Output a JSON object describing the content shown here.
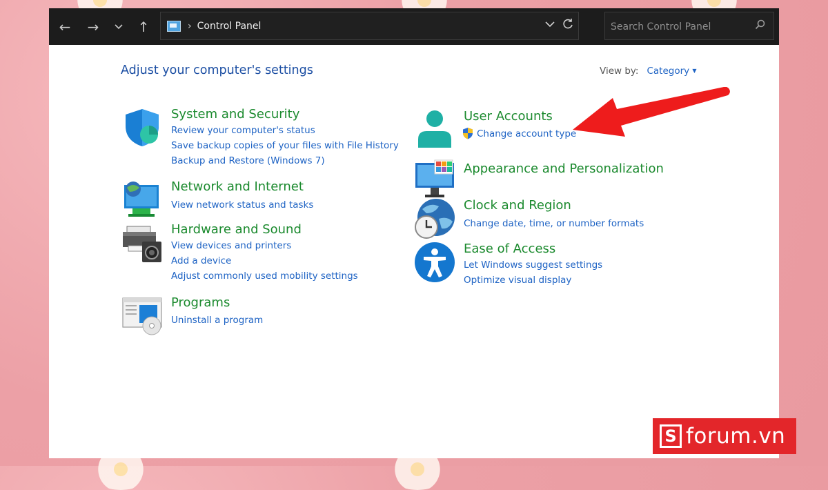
{
  "toolbar": {
    "back_icon": "arrow-left-icon",
    "forward_icon": "arrow-right-icon",
    "recent_icon": "chevron-down-icon",
    "up_icon": "arrow-up-icon",
    "address_separator": "›",
    "address_location": "Control Panel",
    "search_placeholder": "Search Control Panel"
  },
  "page": {
    "heading": "Adjust your computer's settings",
    "view_by_label": "View by:",
    "view_by_value": "Category"
  },
  "categories": {
    "system_security": {
      "title": "System and Security",
      "links": [
        "Review your computer's status",
        "Save backup copies of your files with File History",
        "Backup and Restore (Windows 7)"
      ]
    },
    "network": {
      "title": "Network and Internet",
      "links": [
        "View network status and tasks"
      ]
    },
    "hardware": {
      "title": "Hardware and Sound",
      "links": [
        "View devices and printers",
        "Add a device",
        "Adjust commonly used mobility settings"
      ]
    },
    "programs": {
      "title": "Programs",
      "links": [
        "Uninstall a program"
      ]
    },
    "user_accounts": {
      "title": "User Accounts",
      "links": [
        "Change account type"
      ]
    },
    "appearance": {
      "title": "Appearance and Personalization",
      "links": []
    },
    "clock": {
      "title": "Clock and Region",
      "links": [
        "Change date, time, or number formats"
      ]
    },
    "ease": {
      "title": "Ease of Access",
      "links": [
        "Let Windows suggest settings",
        "Optimize visual display"
      ]
    }
  },
  "colors": {
    "title_green": "#1b8a2e",
    "link_blue": "#1e63c4",
    "heading_blue": "#1b4ea3",
    "toolbar_bg": "#1c1c1c",
    "annotation_red": "#ee1c1c",
    "logo_red": "#e3262a"
  },
  "watermark": {
    "logo_letter": "S",
    "logo_text": "forum.vn"
  }
}
